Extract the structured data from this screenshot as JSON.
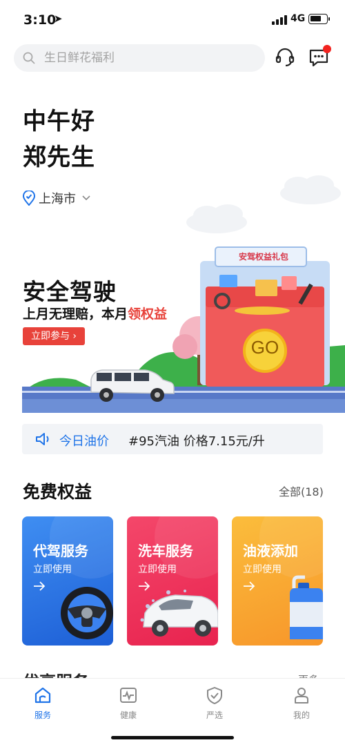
{
  "status_bar": {
    "time": "3:10",
    "network": "4G"
  },
  "search": {
    "placeholder": "生日鲜花福利"
  },
  "greeting": {
    "line1": "中午好",
    "line2": "郑先生"
  },
  "location": {
    "city": "上海市"
  },
  "banner": {
    "title": "安全驾驶",
    "subtitle_prefix": "上月无理赔，本月",
    "subtitle_highlight": "领权益",
    "button_label": "立即参与",
    "button_arrow": "›",
    "gift_label": "安驾权益礼包",
    "go_label": "GO"
  },
  "oil": {
    "label": "今日油价",
    "detail": "#95汽油 价格7.15元/升"
  },
  "free_benefits": {
    "title": "免费权益",
    "all_label": "全部(18)",
    "cards": [
      {
        "title": "代驾服务",
        "action": "立即使用",
        "icon": "steering-wheel-icon"
      },
      {
        "title": "洗车服务",
        "action": "立即使用",
        "icon": "car-wash-icon"
      },
      {
        "title": "油液添加",
        "action": "立即使用",
        "icon": "oil-can-icon"
      }
    ]
  },
  "next_section": {
    "title": "优享服务",
    "more": "更多"
  },
  "tabs": [
    {
      "label": "服务",
      "icon": "service-home-icon",
      "active": true
    },
    {
      "label": "健康",
      "icon": "health-pulse-icon",
      "active": false
    },
    {
      "label": "严选",
      "icon": "shield-check-icon",
      "active": false
    },
    {
      "label": "我的",
      "icon": "profile-icon",
      "active": false
    }
  ],
  "colors": {
    "accent_blue": "#1e73e8",
    "banner_red": "#e8423a",
    "badge_red": "#f2231f",
    "card_blue": "#2f7ae8",
    "card_pink": "#ee3560",
    "card_orange": "#f9a832"
  }
}
